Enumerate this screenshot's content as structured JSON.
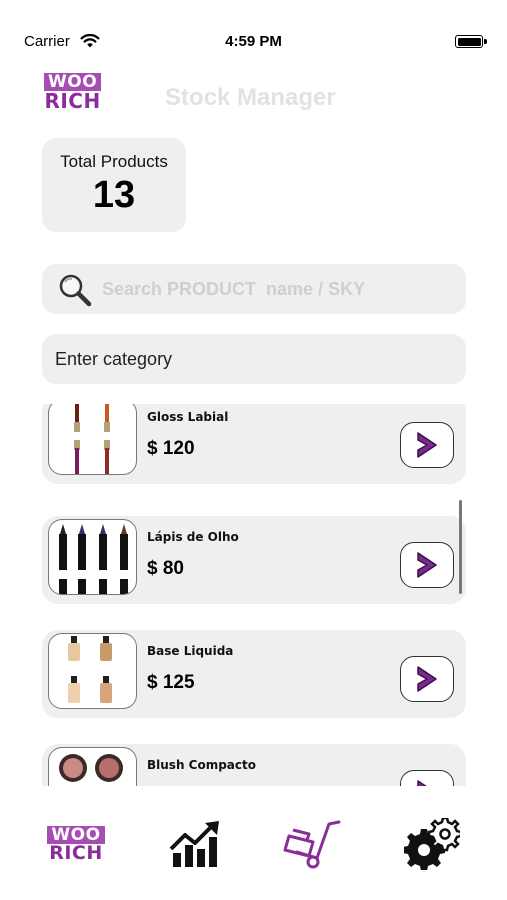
{
  "status_bar": {
    "carrier": "Carrier",
    "time": "4:59 PM",
    "wifi_icon": "wifi-icon",
    "battery_icon": "battery-icon"
  },
  "header": {
    "logo_top": "WOO",
    "logo_bottom": "RICH",
    "title": "Stock Manager"
  },
  "summary": {
    "total_label": "Total Products",
    "total_value": "13"
  },
  "search": {
    "placeholder": "Search PRODUCT  name / SKY",
    "icon": "search-icon"
  },
  "category": {
    "placeholder": "Enter category"
  },
  "products": [
    {
      "name": "Gloss Labial",
      "price": "$ 120",
      "thumb_icon": "lip-gloss-image"
    },
    {
      "name": "Lápis de Olho",
      "price": "$ 80",
      "thumb_icon": "eye-pencil-image"
    },
    {
      "name": "Base Liquida",
      "price": "$ 125",
      "thumb_icon": "liquid-foundation-image"
    },
    {
      "name": "Blush Compacto",
      "price": "",
      "thumb_icon": "blush-compact-image"
    }
  ],
  "tab_bar": {
    "items": [
      {
        "name": "home",
        "logo_top": "WOO",
        "logo_bottom": "RICH"
      },
      {
        "name": "analytics",
        "icon": "bar-chart-trend-icon"
      },
      {
        "name": "inventory",
        "icon": "hand-truck-icon",
        "active": true
      },
      {
        "name": "settings",
        "icon": "gears-icon"
      }
    ]
  },
  "colors": {
    "brand_purple": "#a64db3",
    "brand_purple_dark": "#8a2c99",
    "card_bg": "#efefef",
    "title_gray": "#e2e2e2"
  }
}
